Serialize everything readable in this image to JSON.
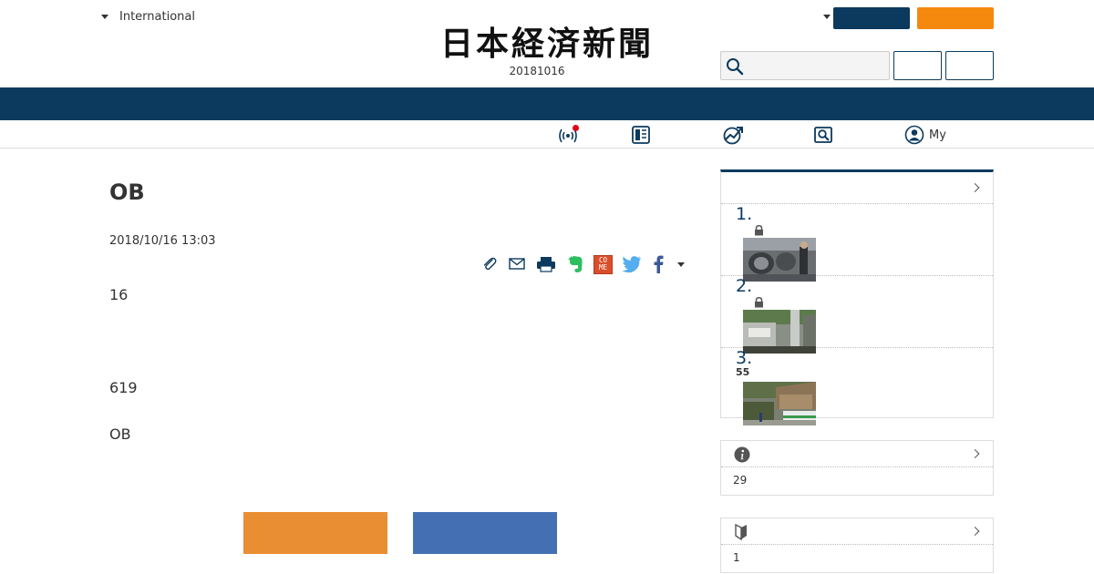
{
  "header": {
    "region_label": "International",
    "logo_text": "日本経済新聞",
    "edition_date": "20181016",
    "search": {
      "placeholder": ""
    }
  },
  "subnav": [
    {
      "icon": "live-broadcast-icon",
      "label": ""
    },
    {
      "icon": "paper-edition-icon",
      "label": ""
    },
    {
      "icon": "market-chart-icon",
      "label": ""
    },
    {
      "icon": "search-topic-icon",
      "label": ""
    },
    {
      "icon": "user-circle-icon",
      "label": "My"
    }
  ],
  "article": {
    "title": "OB",
    "date": "2018/10/16 13:03",
    "paragraphs": [
      "16",
      "619",
      "OB"
    ]
  },
  "share_icons": [
    "clip-icon",
    "mail-icon",
    "print-icon",
    "evernote-icon",
    "come-icon",
    "twitter-icon",
    "facebook-icon",
    "more-dropdown-icon"
  ],
  "come_icon_text": "CO ME",
  "ranking": {
    "items": [
      {
        "rank": "1.",
        "locked": true,
        "extra": ""
      },
      {
        "rank": "2.",
        "locked": true,
        "extra": ""
      },
      {
        "rank": "3.",
        "locked": false,
        "extra": "55"
      }
    ]
  },
  "info_box": {
    "icon": "info-icon",
    "value": "29"
  },
  "beginner_box": {
    "icon": "beginner-mark-icon",
    "value": "1"
  },
  "colors": {
    "navy": "#0c3a5e",
    "orange": "#f5890d",
    "cta_orange": "#ea8e33",
    "cta_blue": "#4470b3",
    "alert_red": "#e0001b"
  }
}
